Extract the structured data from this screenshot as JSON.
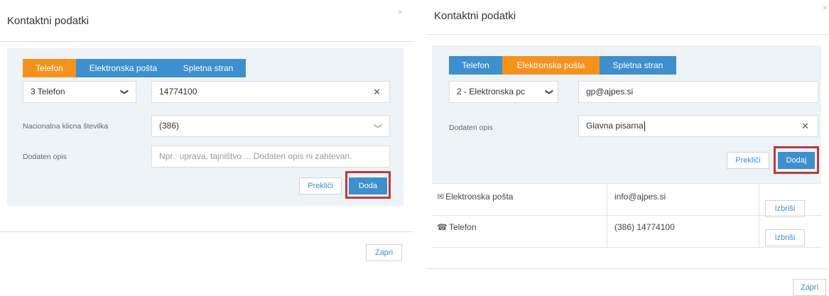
{
  "left": {
    "title": "Kontaktni podatki",
    "close": "×",
    "tabs": [
      "Telefon",
      "Elektronska pošta",
      "Spletna stran"
    ],
    "type_select": "3 Telefon",
    "number_value": "14774100",
    "national_label": "Nacionalna klicna številka",
    "national_value": "(386)",
    "desc_label": "Dodaten opis",
    "desc_placeholder": "Npr.: uprava, tajništvo ... Dodaten opis ni zahtevan.",
    "cancel": "Prekliči",
    "add": "Doda",
    "close_button": "Zapri"
  },
  "right": {
    "title": "Kontaktni podatki",
    "close": "×",
    "tabs": [
      "Telefon",
      "Elektronska pošta",
      "Spletna stran"
    ],
    "type_select": "2 - Elektronska pc",
    "email_value": "gp@ajpes.si",
    "desc_label": "Dodaten opis",
    "desc_value": "Glavna pisarna",
    "cancel": "Prekliči",
    "add": "Dodaj",
    "rows": [
      {
        "type": "Elektronska pošta",
        "value": "info@ajpes.si",
        "action": "Izbriši"
      },
      {
        "type": "Telefon",
        "value": "(386) 14774100",
        "action": "Izbriši"
      }
    ],
    "close_button": "Zapri"
  },
  "icons": {
    "close": "close-icon",
    "chevron": "chevron-down-icon",
    "clear": "clear-icon",
    "email": "envelope-icon",
    "phone": "phone-icon"
  }
}
